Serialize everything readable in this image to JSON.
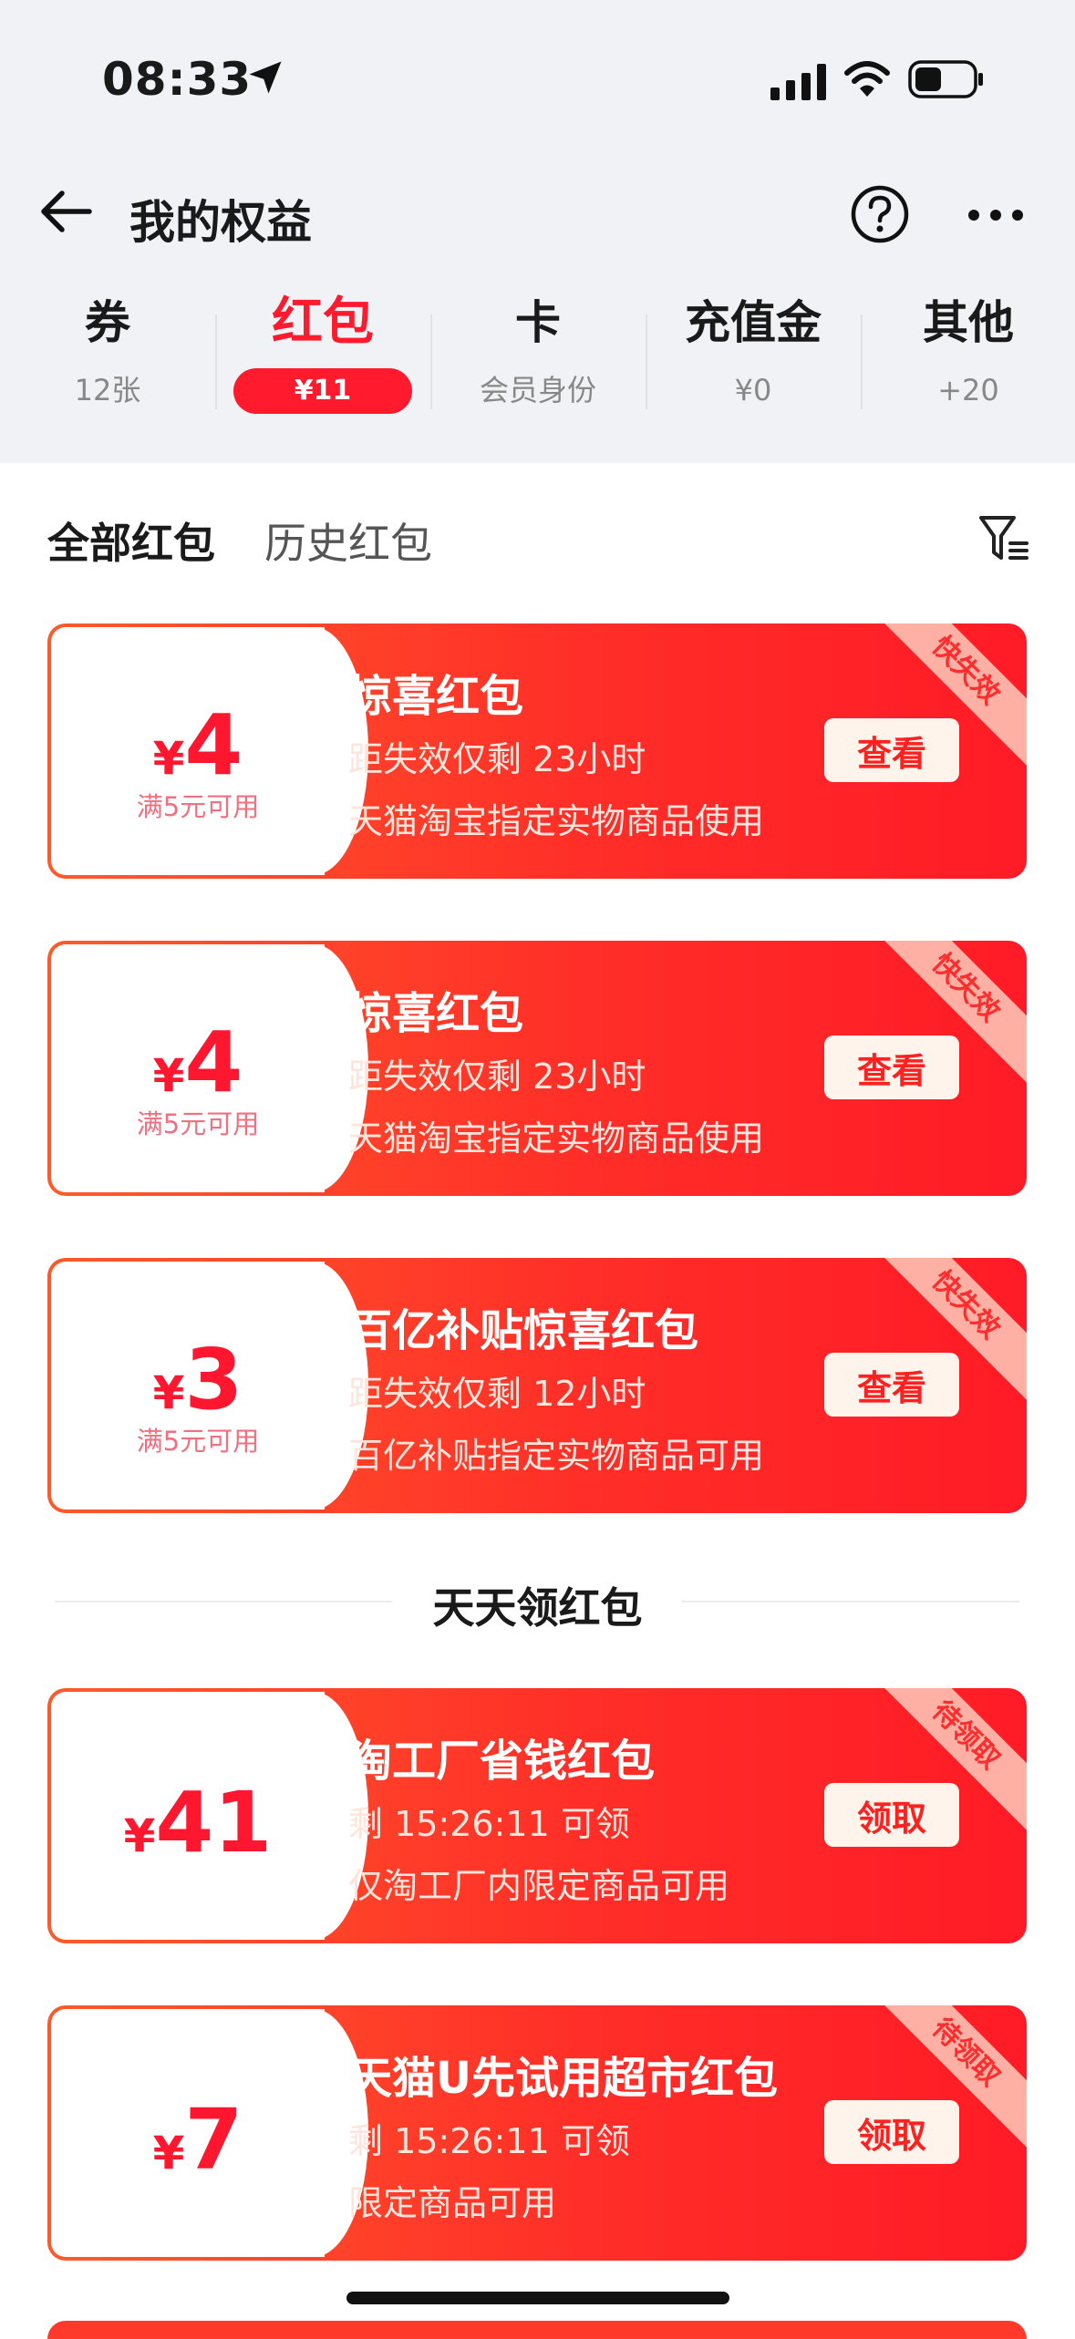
{
  "status_bar": {
    "time": "08:33"
  },
  "header": {
    "title": "我的权益"
  },
  "tabs": [
    {
      "label": "券",
      "sub": "12张"
    },
    {
      "label": "红包",
      "sub": "¥11"
    },
    {
      "label": "卡",
      "sub": "会员身份"
    },
    {
      "label": "充值金",
      "sub": "¥0"
    },
    {
      "label": "其他",
      "sub": "+20"
    }
  ],
  "subtabs": {
    "all": "全部红包",
    "history": "历史红包"
  },
  "cards": [
    {
      "currency": "¥",
      "amount": "4",
      "condition": "满5元可用",
      "title": "惊喜红包",
      "line1": "距失效仅剩 23小时",
      "line2": "天猫淘宝指定实物商品使用",
      "button": "查看",
      "ribbon": "快失效"
    },
    {
      "currency": "¥",
      "amount": "4",
      "condition": "满5元可用",
      "title": "惊喜红包",
      "line1": "距失效仅剩 23小时",
      "line2": "天猫淘宝指定实物商品使用",
      "button": "查看",
      "ribbon": "快失效"
    },
    {
      "currency": "¥",
      "amount": "3",
      "condition": "满5元可用",
      "title": "百亿补贴惊喜红包",
      "line1": "距失效仅剩 12小时",
      "line2": "百亿补贴指定实物商品可用",
      "button": "查看",
      "ribbon": "快失效"
    }
  ],
  "section": {
    "title": "天天领红包"
  },
  "claim_cards": [
    {
      "currency": "¥",
      "amount": "41",
      "title": "淘工厂省钱红包",
      "line1": "剩 15:26:11   可领",
      "line2": "仅淘工厂内限定商品可用",
      "button": "领取",
      "ribbon": "待领取"
    },
    {
      "currency": "¥",
      "amount": "7",
      "title": "天猫U先试用超市红包",
      "line1": "剩 15:26:11   可领",
      "line2": "限定商品可用",
      "button": "领取",
      "ribbon": "待领取"
    }
  ],
  "colors": {
    "accent": "#ff1a2e",
    "card_gradient_start": "#ff5a2b",
    "card_gradient_end": "#ff1b26",
    "page_bg": "#f1f2f6"
  }
}
